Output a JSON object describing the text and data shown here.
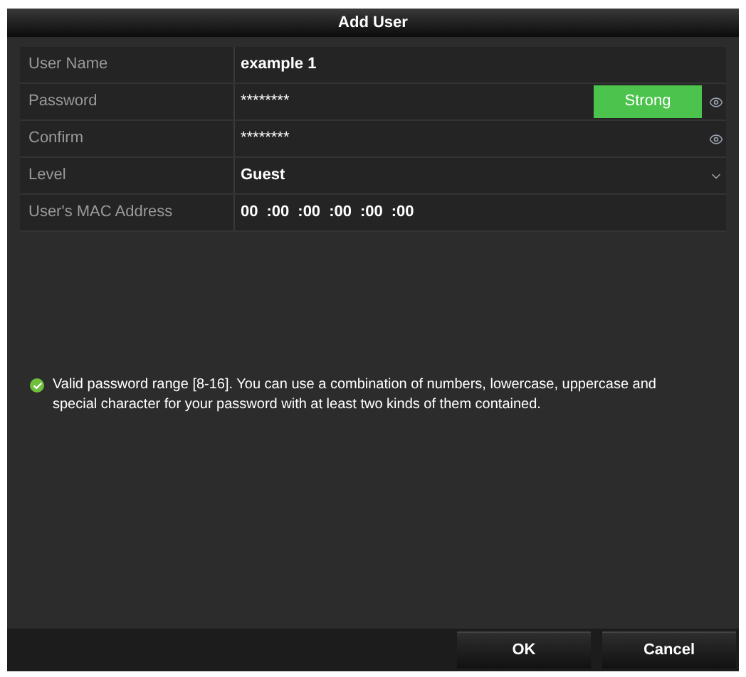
{
  "window": {
    "title": "Add User"
  },
  "fields": [
    {
      "kind": "text",
      "label": "User Name",
      "value": "example 1"
    },
    {
      "kind": "password",
      "label": "Password",
      "value": "********",
      "strength": "Strong"
    },
    {
      "kind": "password",
      "label": "Confirm",
      "value": "********"
    },
    {
      "kind": "select",
      "label": "Level",
      "value": "Guest"
    },
    {
      "kind": "mac",
      "label": "User's MAC Address",
      "octets": [
        "00",
        ":00",
        ":00",
        ":00",
        ":00",
        ":00"
      ]
    }
  ],
  "hint": "Valid password range [8-16]. You can use a combination of numbers, lowercase, uppercase and special character for your password with at least two kinds of them contained.",
  "buttons": [
    "OK",
    "Cancel"
  ]
}
